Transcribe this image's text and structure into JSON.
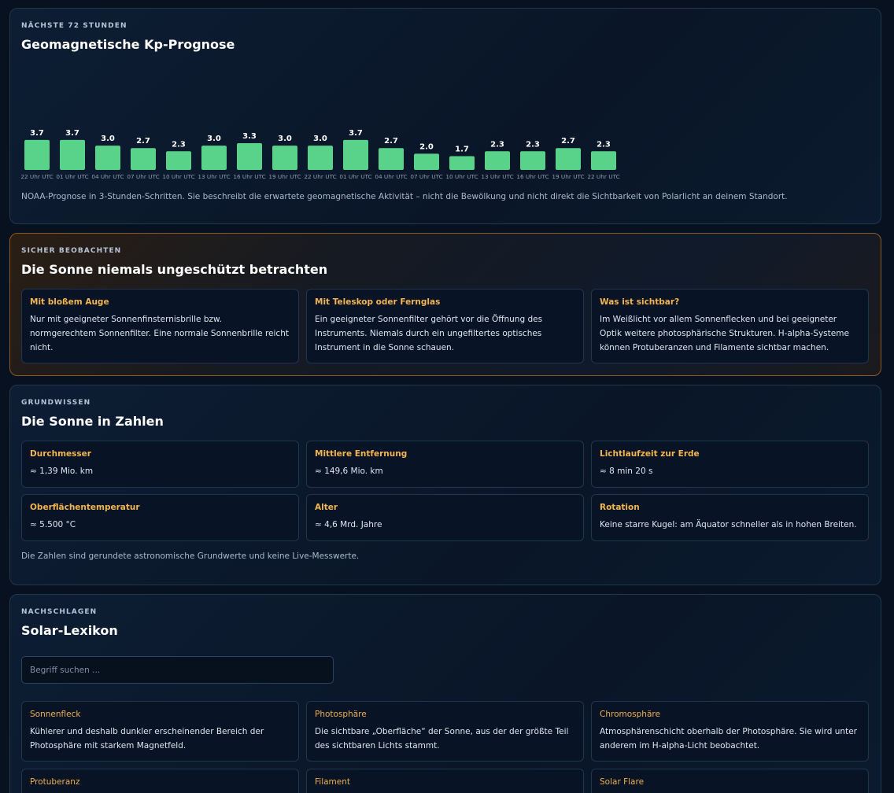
{
  "kp": {
    "eyebrow": "NÄCHSTE 72 STUNDEN",
    "title": "Geomagnetische Kp-Prognose",
    "note": "NOAA-Prognose in 3-Stunden-Schritten. Sie beschreibt die erwartete geomagnetische Aktivität – nicht die Bewölkung und nicht direkt die Sichtbarkeit von Polarlicht an deinem Standort.",
    "bar_color": "#5ad38a"
  },
  "chart_data": {
    "type": "bar",
    "categories": [
      "22 Uhr UTC",
      "01 Uhr UTC",
      "04 Uhr UTC",
      "07 Uhr UTC",
      "10 Uhr UTC",
      "13 Uhr UTC",
      "16 Uhr UTC",
      "19 Uhr UTC",
      "22 Uhr UTC",
      "01 Uhr UTC",
      "04 Uhr UTC",
      "07 Uhr UTC",
      "10 Uhr UTC",
      "13 Uhr UTC",
      "16 Uhr UTC",
      "19 Uhr UTC",
      "22 Uhr UTC"
    ],
    "values": [
      3.7,
      3.7,
      3.0,
      2.7,
      2.3,
      3.0,
      3.3,
      3.0,
      3.0,
      3.7,
      2.7,
      2.0,
      1.7,
      2.3,
      2.3,
      2.7,
      2.3
    ],
    "value_labels": [
      "3.7",
      "3.7",
      "3.0",
      "2.7",
      "2.3",
      "3.0",
      "3.3",
      "3.0",
      "3.0",
      "3.7",
      "2.7",
      "2.0",
      "1.7",
      "2.3",
      "2.3",
      "2.7",
      "2.3"
    ],
    "title": "",
    "xlabel": "",
    "ylabel": "",
    "ylim": [
      0,
      9
    ],
    "grid": false
  },
  "safety": {
    "eyebrow": "SICHER BEOBACHTEN",
    "title": "Die Sonne niemals ungeschützt betrachten",
    "cards": [
      {
        "title": "Mit bloßem Auge",
        "body": "Nur mit geeigneter Sonnenfinsternisbrille bzw. normgerechtem Sonnenfilter. Eine normale Sonnenbrille reicht nicht."
      },
      {
        "title": "Mit Teleskop oder Fernglas",
        "body": "Ein geeigneter Sonnenfilter gehört vor die Öffnung des Instruments. Niemals durch ein ungefiltertes optisches Instrument in die Sonne schauen."
      },
      {
        "title": "Was ist sichtbar?",
        "body": "Im Weißlicht vor allem Sonnenflecken und bei geeigneter Optik weitere photosphärische Strukturen. H-alpha-Systeme können Protuberanzen und Filamente sichtbar machen."
      }
    ]
  },
  "facts": {
    "eyebrow": "GRUNDWISSEN",
    "title": "Die Sonne in Zahlen",
    "cards": [
      {
        "title": "Durchmesser",
        "body": "≈ 1,39 Mio. km"
      },
      {
        "title": "Mittlere Entfernung",
        "body": "≈ 149,6 Mio. km"
      },
      {
        "title": "Lichtlaufzeit zur Erde",
        "body": "≈ 8 min 20 s"
      },
      {
        "title": "Oberflächentemperatur",
        "body": "≈ 5.500 °C"
      },
      {
        "title": "Alter",
        "body": "≈ 4,6 Mrd. Jahre"
      },
      {
        "title": "Rotation",
        "body": "Keine starre Kugel: am Äquator schneller als in hohen Breiten."
      }
    ],
    "note": "Die Zahlen sind gerundete astronomische Grundwerte und keine Live-Messwerte."
  },
  "lexikon": {
    "eyebrow": "NACHSCHLAGEN",
    "title": "Solar-Lexikon",
    "search_placeholder": "Begriff suchen ...",
    "search_value": "",
    "cards": [
      {
        "title": "Sonnenfleck",
        "body": "Kühlerer und deshalb dunkler erscheinender Bereich der Photosphäre mit starkem Magnetfeld."
      },
      {
        "title": "Photosphäre",
        "body": "Die sichtbare „Oberfläche“ der Sonne, aus der der größte Teil des sichtbaren Lichts stammt."
      },
      {
        "title": "Chromosphäre",
        "body": "Atmosphärenschicht oberhalb der Photosphäre. Sie wird unter anderem im H-alpha-Licht beobachtet."
      },
      {
        "title": "Protuberanz",
        "body": ""
      },
      {
        "title": "Filament",
        "body": ""
      },
      {
        "title": "Solar Flare",
        "body": ""
      }
    ]
  }
}
